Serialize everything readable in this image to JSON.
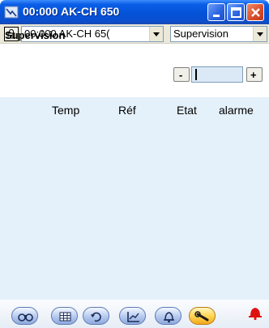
{
  "window": {
    "title": "00:000 AK-CH 650",
    "buttons": [
      "minimize",
      "maximize",
      "close"
    ]
  },
  "toolbar": {
    "controller_select": {
      "value": "00:000 AK-CH 650",
      "displayed": "00:000 AK-CH 65("
    },
    "view_select": {
      "value": "Supervision"
    }
  },
  "section": {
    "title": "Supervision",
    "spinner": {
      "prev_label": "-",
      "next_label": "+"
    }
  },
  "table": {
    "columns": [
      "Temp",
      "Réf",
      "Etat",
      "alarme"
    ],
    "rows": []
  },
  "bottom_toolbar": {
    "buttons": [
      {
        "icon": "binoculars-icon",
        "active": false
      },
      {
        "icon": "grid-icon",
        "active": false
      },
      {
        "icon": "refresh-icon",
        "active": false
      },
      {
        "icon": "graph-icon",
        "active": false
      },
      {
        "icon": "bell-outline-icon",
        "active": false
      },
      {
        "icon": "wrench-icon",
        "active": true
      }
    ],
    "alarm_indicator": {
      "icon": "red-bell-icon",
      "color": "#e01010"
    }
  },
  "colors": {
    "titlebar": "#0453d8",
    "table_background": "#e4f0fa",
    "toolbar_background": "#ece9d8",
    "active_button": "#ffd24d"
  }
}
